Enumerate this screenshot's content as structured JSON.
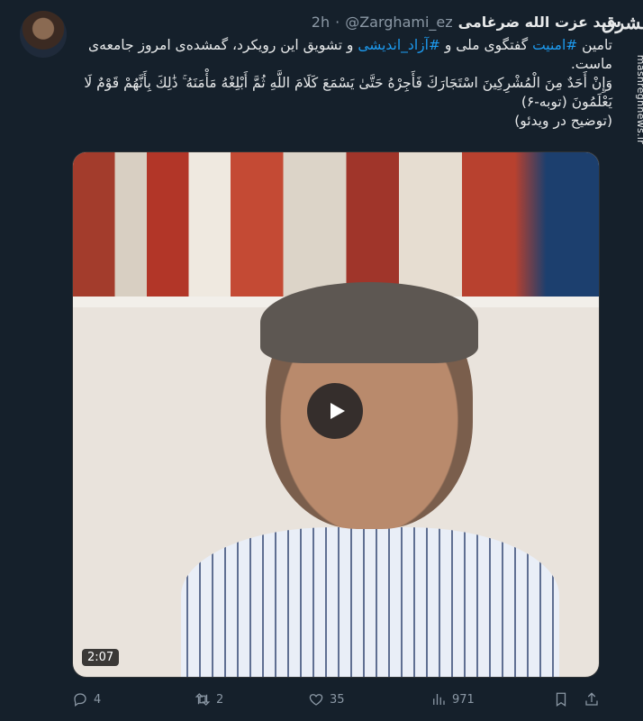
{
  "tweet": {
    "author_name": "سید عزت الله ضرغامی",
    "author_handle": "@Zarghami_ez",
    "separator": "·",
    "time": "2h",
    "text_line1_a": "تامین ",
    "hashtag1": "#امنیت",
    "text_line1_b": " گفتگوی ملی و ",
    "hashtag2": "#آزاد_اندیشی",
    "text_line1_c": " و تشویق این رویکرد، گمشده‌ی امروز جامعه‌ی ماست.",
    "verse": "وَإِنْ أَحَدٌ مِنَ الْمُشْرِكِينَ اسْتَجَارَكَ فَأَجِرْهُ حَتَّىٰ يَسْمَعَ كَلَامَ اللَّهِ ثُمَّ أَبْلِغْهُ مَأْمَنَهُ ۚ ذَٰلِكَ بِأَنَّهُمْ قَوْمٌ لَا يَعْلَمُونَ (توبه-۶)",
    "note": "(توضیح در ویدئو)"
  },
  "video": {
    "duration": "2:07"
  },
  "actions": {
    "replies": "4",
    "retweets": "2",
    "likes": "35",
    "views": "971"
  },
  "watermark": {
    "logo_text": "مشرق",
    "url": "mashreghnews.ir"
  },
  "icons": {
    "play": "play-icon",
    "reply": "reply-icon",
    "retweet": "retweet-icon",
    "like": "heart-icon",
    "views": "bar-chart-icon",
    "bookmark": "bookmark-icon",
    "share": "share-icon"
  }
}
